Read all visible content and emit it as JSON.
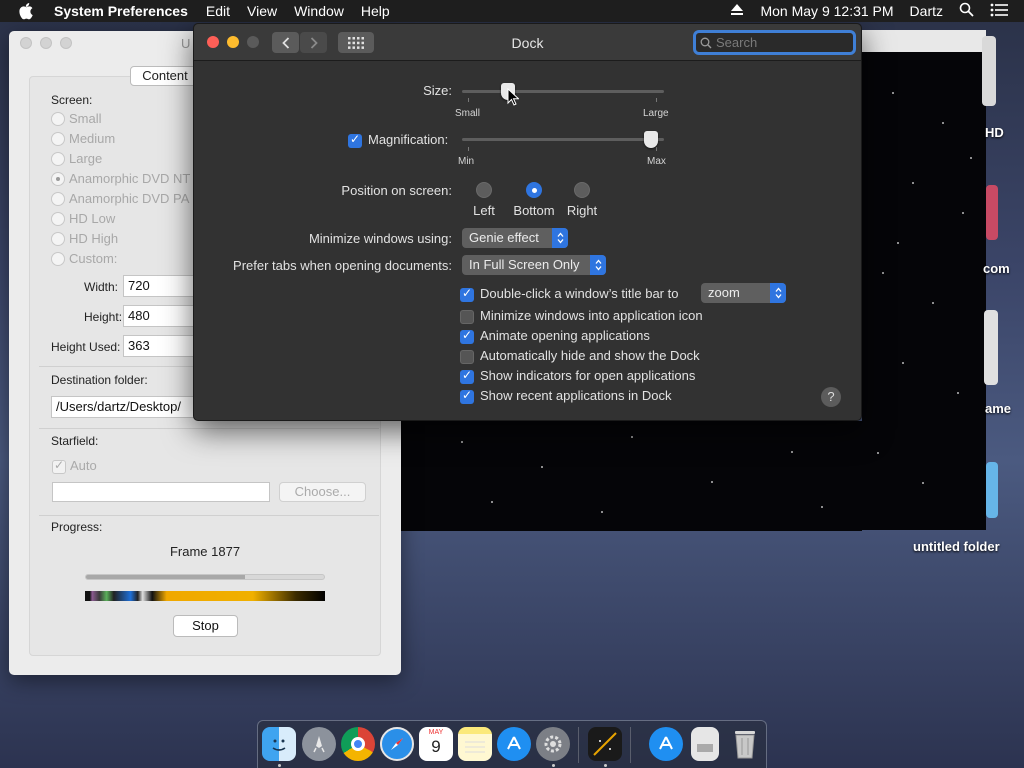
{
  "menubar": {
    "app_name": "System Preferences",
    "menus": [
      "Edit",
      "View",
      "Window",
      "Help"
    ],
    "datetime": "Mon May 9  12:31 PM",
    "user": "Dartz"
  },
  "left_window": {
    "title_fragment": "U",
    "content_tab": "Content",
    "screen_label": "Screen:",
    "screen_options": [
      "Small",
      "Medium",
      "Large",
      "Anamorphic DVD NT",
      "Anamorphic DVD PA",
      "HD Low",
      "HD High",
      "Custom:"
    ],
    "width_label": "Width:",
    "width_value": "720",
    "height_label": "Height:",
    "height_value": "480",
    "height_used_label": "Height Used:",
    "height_used_value": "363",
    "destination_label": "Destination folder:",
    "destination_value": "/Users/dartz/Desktop/",
    "starfield_label": "Starfield:",
    "auto_label": "Auto",
    "choose_label": "Choose...",
    "progress_label": "Progress:",
    "frame_text": "Frame 1877",
    "progress_fraction": 0.67,
    "stop_label": "Stop"
  },
  "dock_window": {
    "title": "Dock",
    "search_placeholder": "Search",
    "size_label": "Size:",
    "size_small": "Small",
    "size_large": "Large",
    "size_value": 0.21,
    "magnification_label": "Magnification:",
    "magnification_checked": true,
    "mag_min": "Min",
    "mag_max": "Max",
    "mag_value": 0.97,
    "position_label": "Position on screen:",
    "positions": [
      "Left",
      "Bottom",
      "Right"
    ],
    "position_selected": "Bottom",
    "minimize_label": "Minimize windows using:",
    "minimize_value": "Genie effect",
    "tabs_label": "Prefer tabs when opening documents:",
    "tabs_value": "In Full Screen Only",
    "doubleclick_label": "Double-click a window’s title bar to",
    "doubleclick_value": "zoom",
    "checkboxes": [
      {
        "label": "Minimize windows into application icon",
        "checked": false
      },
      {
        "label": "Animate opening applications",
        "checked": true
      },
      {
        "label": "Automatically hide and show the Dock",
        "checked": false
      },
      {
        "label": "Show indicators for open applications",
        "checked": true
      },
      {
        "label": "Show recent applications in Dock",
        "checked": true
      }
    ],
    "help": "?"
  },
  "desktop": {
    "labels": [
      "HD",
      "com",
      "ame",
      "untitled folder"
    ]
  },
  "dock": {
    "calendar_month": "MAY",
    "calendar_day": "9"
  },
  "colors": {
    "accent": "#2f75e0",
    "window_dark": "#323232",
    "menubar": "#1e1e1e"
  }
}
